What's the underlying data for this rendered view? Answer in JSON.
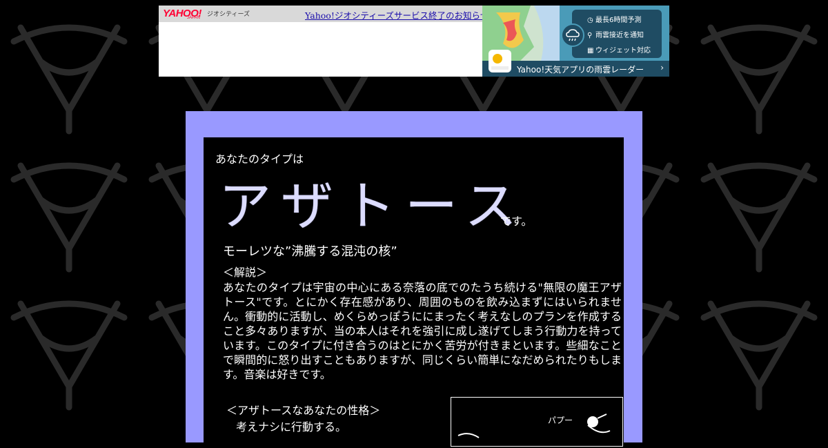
{
  "banner": {
    "logo_text": "YAHOO!",
    "logo_sub": "JAPAN",
    "service_label": "ジオシティーズ",
    "notice_link": "Yahoo!ジオシティーズサービス終了のお知らせ"
  },
  "ad": {
    "features": [
      "最長6時間予測",
      "雨雲接近を通知",
      "ウィジェット対応"
    ],
    "app_label": "Yahoo!天気アプリの雨雲レーダー",
    "chevron": "›",
    "feature_icons": [
      "clock-icon",
      "pin-icon",
      "widget-icon"
    ]
  },
  "content": {
    "intro": "あなたのタイプは",
    "type_name": "アザトース",
    "suffix": "です。",
    "subtitle": "モーレツな”沸騰する混沌の核”",
    "kaisetsu_head": "＜解説＞",
    "kaisetsu_body": "あなたのタイプは宇宙の中心にある奈落の底でのたうち続ける\"無限の魔王アザトース\"です。とにかく存在感があり、周囲のものを飲み込まずにはいられません。衝動的に活動し、めくらめっぽうににまったく考えなしのプランを作成すること多々ありますが、当の本人はそれを強引に成し遂げてしまう行動力を持っています。このタイプに付き合うのはとにかく苦労が付きまといます。些細なことで瞬間的に怒り出すこともありますが、同じくらい簡単になだめられたりもします。音楽は好きです。",
    "trait_head": "＜アザトースなあなたの性格＞",
    "trait_item": "考えナシに行動する。",
    "illust_text": "パプー"
  },
  "colors": {
    "frame": "#9999ff",
    "background": "#000000",
    "type_name": "#dcdcff",
    "link": "#1a0dab"
  }
}
